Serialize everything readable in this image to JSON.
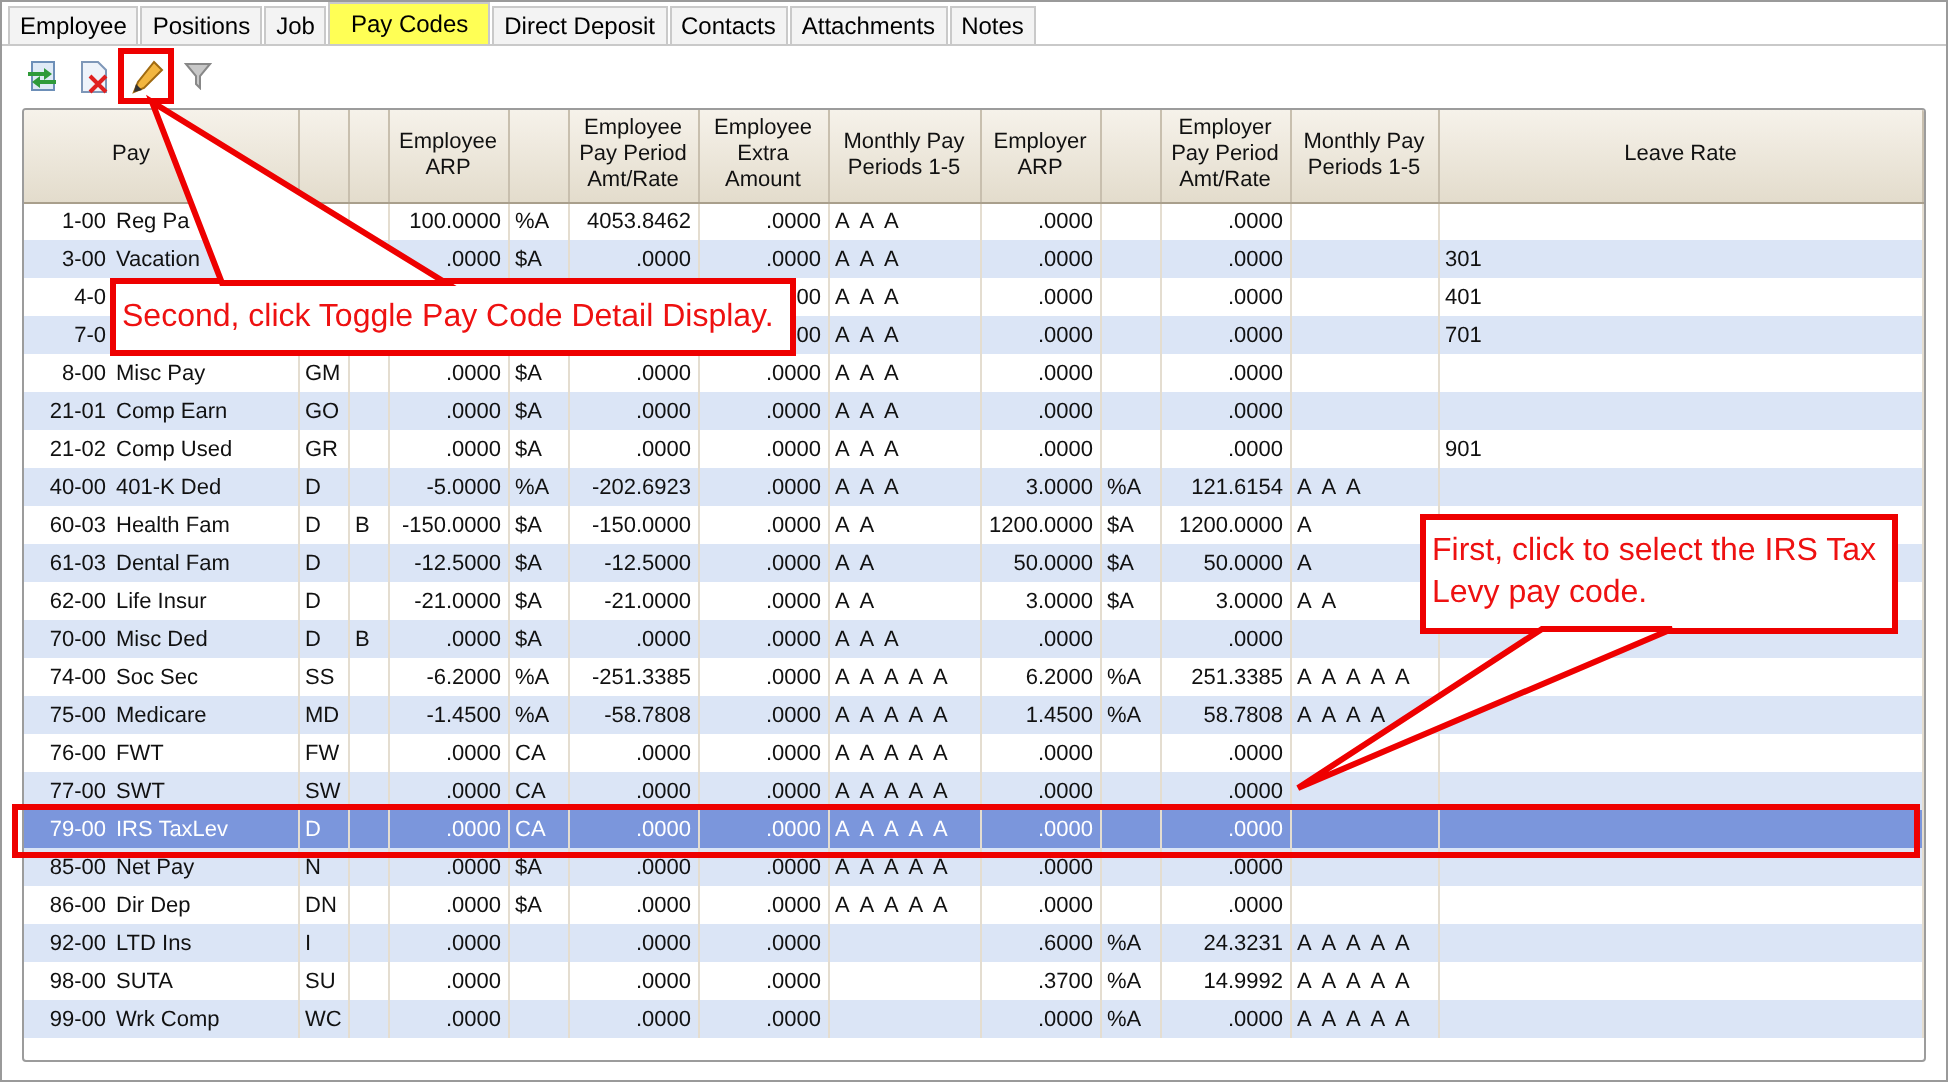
{
  "tabs": [
    {
      "label": "Employee",
      "selected": false
    },
    {
      "label": "Positions",
      "selected": false
    },
    {
      "label": "Job",
      "selected": false
    },
    {
      "label": "Pay Codes",
      "selected": true
    },
    {
      "label": "Direct Deposit",
      "selected": false
    },
    {
      "label": "Contacts",
      "selected": false
    },
    {
      "label": "Attachments",
      "selected": false
    },
    {
      "label": "Notes",
      "selected": false
    }
  ],
  "toolbar": [
    {
      "kind": "import"
    },
    {
      "kind": "delete"
    },
    {
      "kind": "edit",
      "highlighted": true
    },
    {
      "kind": "filter"
    }
  ],
  "table": {
    "columns": [
      {
        "kind": "text",
        "label": "Pay"
      },
      {
        "kind": "blank"
      },
      {
        "kind": "blank"
      },
      {
        "kind": "text",
        "label": "Employee ARP"
      },
      {
        "kind": "blank"
      },
      {
        "kind": "text",
        "label": "Employee Pay Period Amt/Rate"
      },
      {
        "kind": "text",
        "label": "Employee Extra Amount"
      },
      {
        "kind": "text",
        "label": "Monthly Pay Periods 1-5"
      },
      {
        "kind": "text",
        "label": "Employer ARP"
      },
      {
        "kind": "blank"
      },
      {
        "kind": "text",
        "label": "Employer Pay Period Amt/Rate"
      },
      {
        "kind": "text",
        "label": "Monthly Pay Periods 1-5"
      },
      {
        "kind": "text",
        "label": "Leave Rate"
      }
    ],
    "rows": [
      {
        "code": "1-00",
        "name": "Reg Pa",
        "arp": "100.0000",
        "unit": "%A",
        "rate": "4053.8462",
        "extra": ".0000",
        "months": "A  A  A",
        "er_arp": ".0000",
        "er_rate": ".0000",
        "selected": false
      },
      {
        "code": "3-00",
        "name": "Vacation",
        "arp": ".0000",
        "unit": "$A",
        "rate": ".0000",
        "extra": ".0000",
        "months": "A  A  A",
        "er_arp": ".0000",
        "er_rate": ".0000",
        "leave": "301",
        "selected": false
      },
      {
        "code": "4-0",
        "extra": "00",
        "months": "A  A  A",
        "er_arp": ".0000",
        "er_rate": ".0000",
        "leave": "401",
        "selected": false
      },
      {
        "code": "7-0",
        "extra": "00",
        "months": "A  A  A",
        "er_arp": ".0000",
        "er_rate": ".0000",
        "leave": "701",
        "selected": false
      },
      {
        "code": "8-00",
        "name": "Misc Pay",
        "type": "GM",
        "arp": ".0000",
        "unit": "$A",
        "rate": ".0000",
        "extra": ".0000",
        "months": "A  A  A",
        "er_arp": ".0000",
        "er_rate": ".0000",
        "selected": false
      },
      {
        "code": "21-01",
        "name": "Comp Earn",
        "type": "GO",
        "arp": ".0000",
        "unit": "$A",
        "rate": ".0000",
        "extra": ".0000",
        "months": "A  A  A",
        "er_arp": ".0000",
        "er_rate": ".0000",
        "selected": false
      },
      {
        "code": "21-02",
        "name": "Comp Used",
        "type": "GR",
        "arp": ".0000",
        "unit": "$A",
        "rate": ".0000",
        "extra": ".0000",
        "months": "A  A  A",
        "er_arp": ".0000",
        "er_rate": ".0000",
        "leave": "901",
        "selected": false
      },
      {
        "code": "40-00",
        "name": "401-K Ded",
        "type": "D",
        "arp": "-5.0000",
        "unit": "%A",
        "rate": "-202.6923",
        "extra": ".0000",
        "months": "A  A  A",
        "er_arp": "3.0000",
        "er_unit": "%A",
        "er_rate": "121.6154",
        "er_months": "A  A  A",
        "selected": false
      },
      {
        "code": "60-03",
        "name": "Health Fam",
        "type": "D",
        "flag": "B",
        "arp": "-150.0000",
        "unit": "$A",
        "rate": "-150.0000",
        "extra": ".0000",
        "months": "A  A",
        "er_arp": "1200.0000",
        "er_unit": "$A",
        "er_rate": "1200.0000",
        "er_months": "A",
        "selected": false
      },
      {
        "code": "61-03",
        "name": "Dental Fam",
        "type": "D",
        "arp": "-12.5000",
        "unit": "$A",
        "rate": "-12.5000",
        "extra": ".0000",
        "months": "A  A",
        "er_arp": "50.0000",
        "er_unit": "$A",
        "er_rate": "50.0000",
        "er_months": "A",
        "selected": false
      },
      {
        "code": "62-00",
        "name": "Life Insur",
        "type": "D",
        "arp": "-21.0000",
        "unit": "$A",
        "rate": "-21.0000",
        "extra": ".0000",
        "months": "A  A",
        "er_arp": "3.0000",
        "er_unit": "$A",
        "er_rate": "3.0000",
        "er_months": "A  A",
        "selected": false
      },
      {
        "code": "70-00",
        "name": "Misc Ded",
        "type": "D",
        "flag": "B",
        "arp": ".0000",
        "unit": "$A",
        "rate": ".0000",
        "extra": ".0000",
        "months": "A  A  A",
        "er_arp": ".0000",
        "er_rate": ".0000",
        "selected": false
      },
      {
        "code": "74-00",
        "name": "Soc Sec",
        "type": "SS",
        "arp": "-6.2000",
        "unit": "%A",
        "rate": "-251.3385",
        "extra": ".0000",
        "months": "A  A  A  A  A",
        "er_arp": "6.2000",
        "er_unit": "%A",
        "er_rate": "251.3385",
        "er_months": "A  A  A  A  A",
        "selected": false
      },
      {
        "code": "75-00",
        "name": "Medicare",
        "type": "MD",
        "arp": "-1.4500",
        "unit": "%A",
        "rate": "-58.7808",
        "extra": ".0000",
        "months": "A  A  A  A  A",
        "er_arp": "1.4500",
        "er_unit": "%A",
        "er_rate": "58.7808",
        "er_months": "A  A  A  A",
        "selected": false
      },
      {
        "code": "76-00",
        "name": "FWT",
        "type": "FW",
        "arp": ".0000",
        "unit": "CA",
        "rate": ".0000",
        "extra": ".0000",
        "months": "A  A  A  A  A",
        "er_arp": ".0000",
        "er_rate": ".0000",
        "selected": false
      },
      {
        "code": "77-00",
        "name": "SWT",
        "type": "SW",
        "arp": ".0000",
        "unit": "CA",
        "rate": ".0000",
        "extra": ".0000",
        "months": "A  A  A  A  A",
        "er_arp": ".0000",
        "er_rate": ".0000",
        "selected": false
      },
      {
        "code": "79-00",
        "name": "IRS TaxLev",
        "type": "D",
        "arp": ".0000",
        "unit": "CA",
        "rate": ".0000",
        "extra": ".0000",
        "months": "A  A  A  A  A",
        "er_arp": ".0000",
        "er_rate": ".0000",
        "selected": true
      },
      {
        "code": "85-00",
        "name": "Net Pay",
        "type": "N",
        "arp": ".0000",
        "unit": "$A",
        "rate": ".0000",
        "extra": ".0000",
        "months": "A  A  A  A  A",
        "er_arp": ".0000",
        "er_rate": ".0000",
        "selected": false
      },
      {
        "code": "86-00",
        "name": "Dir Dep",
        "type": "DN",
        "arp": ".0000",
        "unit": "$A",
        "rate": ".0000",
        "extra": ".0000",
        "months": "A  A  A  A  A",
        "er_arp": ".0000",
        "er_rate": ".0000",
        "selected": false
      },
      {
        "code": "92-00",
        "name": "LTD Ins",
        "type": "I",
        "arp": ".0000",
        "rate": ".0000",
        "extra": ".0000",
        "er_arp": ".6000",
        "er_unit": "%A",
        "er_rate": "24.3231",
        "er_months": "A  A  A  A  A",
        "selected": false
      },
      {
        "code": "98-00",
        "name": "SUTA",
        "type": "SU",
        "arp": ".0000",
        "rate": ".0000",
        "extra": ".0000",
        "er_arp": ".3700",
        "er_unit": "%A",
        "er_rate": "14.9992",
        "er_months": "A  A  A  A  A",
        "selected": false
      },
      {
        "code": "99-00",
        "name": "Wrk Comp",
        "type": "WC",
        "arp": ".0000",
        "rate": ".0000",
        "extra": ".0000",
        "er_arp": ".0000",
        "er_unit": "%A",
        "er_rate": ".0000",
        "er_months": "A  A  A  A  A",
        "selected": false
      }
    ]
  },
  "callouts": [
    {
      "text": "Second, click Toggle Pay Code Detail Display.",
      "kind": "upper"
    },
    {
      "text": "First, click to select the IRS Tax Levy pay code.",
      "kind": "lower"
    }
  ]
}
